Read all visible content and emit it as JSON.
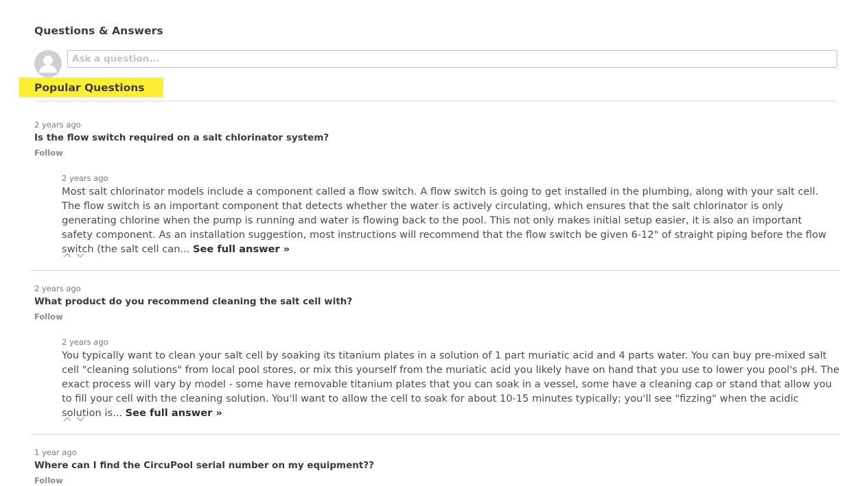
{
  "qa": {
    "title": "Questions & Answers",
    "ask_placeholder": "Ask a question...",
    "popular_title": "Popular Questions"
  },
  "questions": [
    {
      "age": "2 years ago",
      "title": "Is the flow switch required on a salt chlorinator system?",
      "follow_label": "Follow",
      "answer": {
        "age": "2 years ago",
        "text": "Most salt chlorinator models include a component called a flow switch. A flow switch is going to get installed in the plumbing, along with your salt cell. The flow switch is an important component that detects whether the water is actively circulating, which ensures that the salt chlorinator is only generating chlorine when the pump is running and water is flowing back to the pool. This not only makes initial setup easier, it is also an important safety component. As an installation suggestion, most instructions will recommend that the flow switch be given 6-12\" of straight piping before the flow switch (the salt cell can...",
        "see_full": "See full answer »"
      }
    },
    {
      "age": "2 years ago",
      "title": "What product do you recommend cleaning the salt cell with?",
      "follow_label": "Follow",
      "answer": {
        "age": "2 years ago",
        "text": "You typically want to clean your salt cell by soaking its titanium plates in a solution of 1 part muriatic acid and 4 parts water. You can buy pre-mixed salt cell \"cleaning solutions\" from local pool stores, or mix this yourself from the muriatic acid you likely have on hand that you use to lower you pool's pH. The exact process will vary by model - some have removable titanium plates that you can soak in a vessel, some have a cleaning cap or stand that allow you to fill your cell with the cleaning solution. You'll want to allow the cell to soak for about 10-15 minutes typically; you'll see \"fizzing\" when the acidic solution is...",
        "see_full": "See full answer »"
      }
    },
    {
      "age": "1 year ago",
      "title": "Where can I find the CircuPool serial number on my equipment??",
      "follow_label": "Follow"
    }
  ],
  "icons": {
    "avatar": "user-silhouette-icon",
    "upvote": "chevron-up-icon",
    "downvote": "chevron-down-icon"
  },
  "colors": {
    "highlight": "#ffef33",
    "avatar_bg": "#cfcfcf"
  }
}
